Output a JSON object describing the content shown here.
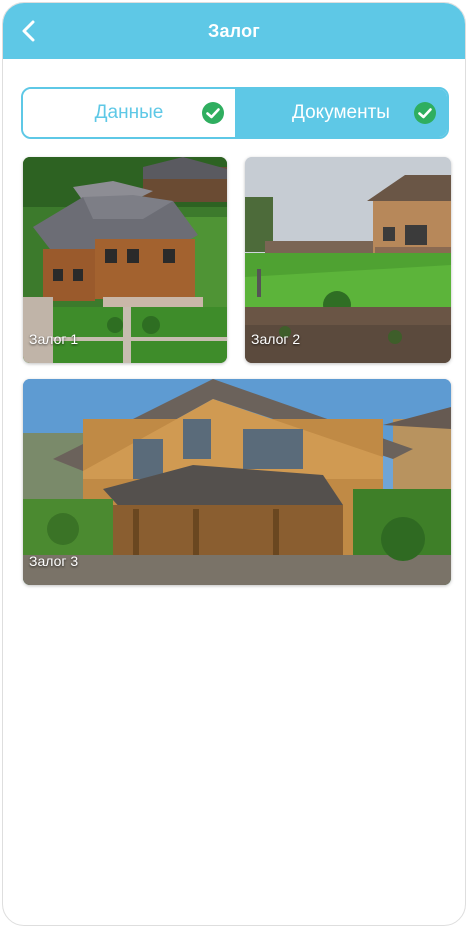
{
  "header": {
    "title": "Залог",
    "back_icon": "chevron-left-icon"
  },
  "tabs": [
    {
      "label": "Данные",
      "active": false,
      "checked": true
    },
    {
      "label": "Документы",
      "active": true,
      "checked": true
    }
  ],
  "gallery": [
    {
      "label": "Залог 1",
      "image": "house-aerial-photo"
    },
    {
      "label": "Залог 2",
      "image": "garden-lawn-photo"
    },
    {
      "label": "Залог 3",
      "image": "wooden-house-terrace-photo"
    }
  ],
  "colors": {
    "accent": "#5ec8e6",
    "check_green": "#2fae5f"
  }
}
